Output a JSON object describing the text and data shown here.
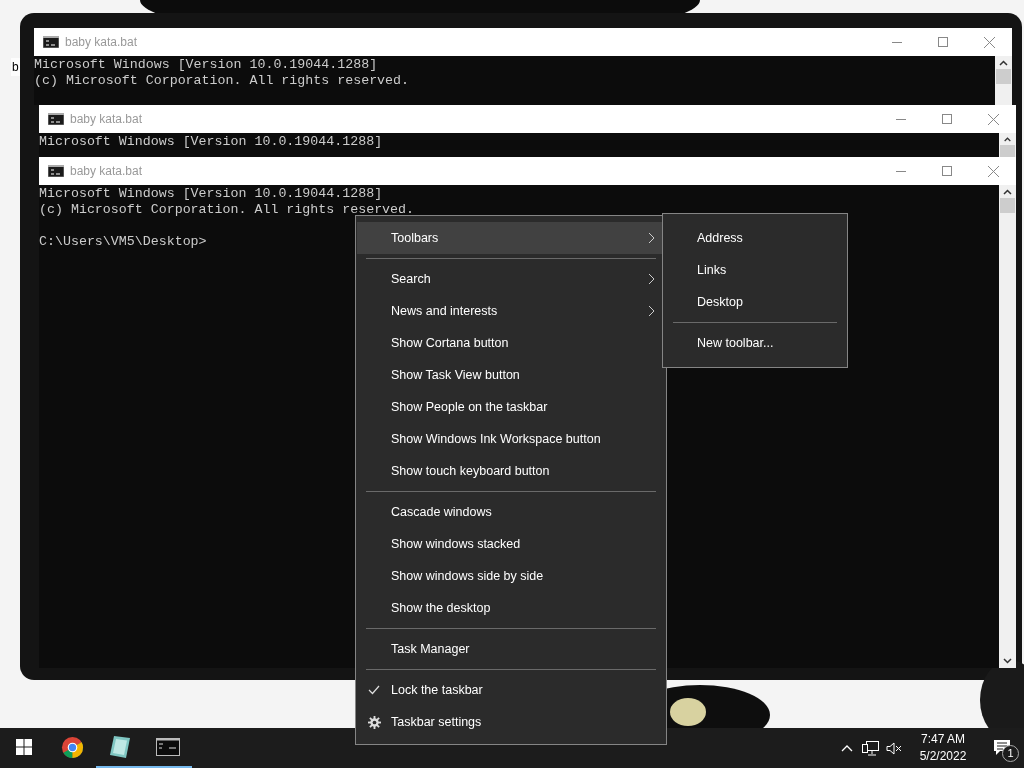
{
  "desktop": {
    "icon_label": "b"
  },
  "windows": [
    {
      "title": "baby kata.bat",
      "paragraphs": [
        [
          "Microsoft Windows [Version 10.0.19044.1288]",
          "(c) Microsoft Corporation. All rights reserved."
        ]
      ]
    },
    {
      "title": "baby kata.bat",
      "paragraphs": [
        [
          "Microsoft Windows [Version 10.0.19044.1288]"
        ]
      ]
    },
    {
      "title": "baby kata.bat",
      "paragraphs": [
        [
          "Microsoft Windows [Version 10.0.19044.1288]",
          "(c) Microsoft Corporation. All rights reserved."
        ],
        [
          "C:\\Users\\VM5\\Desktop>"
        ]
      ]
    }
  ],
  "context_menu": {
    "items": [
      {
        "kind": "item",
        "label": "Toolbars",
        "submenu": true,
        "selected": true
      },
      {
        "kind": "separator"
      },
      {
        "kind": "item",
        "label": "Search",
        "submenu": true,
        "selected": false
      },
      {
        "kind": "item",
        "label": "News and interests",
        "submenu": true,
        "selected": false
      },
      {
        "kind": "item",
        "label": "Show Cortana button",
        "submenu": false,
        "selected": false
      },
      {
        "kind": "item",
        "label": "Show Task View button",
        "submenu": false,
        "selected": false
      },
      {
        "kind": "item",
        "label": "Show People on the taskbar",
        "submenu": false,
        "selected": false
      },
      {
        "kind": "item",
        "label": "Show Windows Ink Workspace button",
        "submenu": false,
        "selected": false
      },
      {
        "kind": "item",
        "label": "Show touch keyboard button",
        "submenu": false,
        "selected": false
      },
      {
        "kind": "separator"
      },
      {
        "kind": "item",
        "label": "Cascade windows",
        "submenu": false,
        "selected": false
      },
      {
        "kind": "item",
        "label": "Show windows stacked",
        "submenu": false,
        "selected": false
      },
      {
        "kind": "item",
        "label": "Show windows side by side",
        "submenu": false,
        "selected": false
      },
      {
        "kind": "item",
        "label": "Show the desktop",
        "submenu": false,
        "selected": false
      },
      {
        "kind": "separator"
      },
      {
        "kind": "item",
        "label": "Task Manager",
        "submenu": false,
        "selected": false
      },
      {
        "kind": "separator"
      },
      {
        "kind": "check",
        "label": "Lock the taskbar",
        "checked": true,
        "selected": false
      },
      {
        "kind": "settings",
        "label": "Taskbar settings",
        "selected": false
      }
    ]
  },
  "submenu": {
    "items": [
      {
        "kind": "item",
        "label": "Address",
        "selected": false
      },
      {
        "kind": "item",
        "label": "Links",
        "selected": false
      },
      {
        "kind": "item",
        "label": "Desktop",
        "selected": false
      },
      {
        "kind": "separator"
      },
      {
        "kind": "item",
        "label": "New toolbar...",
        "selected": false
      }
    ]
  },
  "taskbar": {
    "apps": [
      {
        "kind": "start",
        "running": false
      },
      {
        "kind": "chrome",
        "running": false
      },
      {
        "kind": "notes",
        "running": true
      },
      {
        "kind": "cmd",
        "running": true
      }
    ],
    "time": "7:47 AM",
    "date": "5/2/2022",
    "notification_count": "1"
  }
}
